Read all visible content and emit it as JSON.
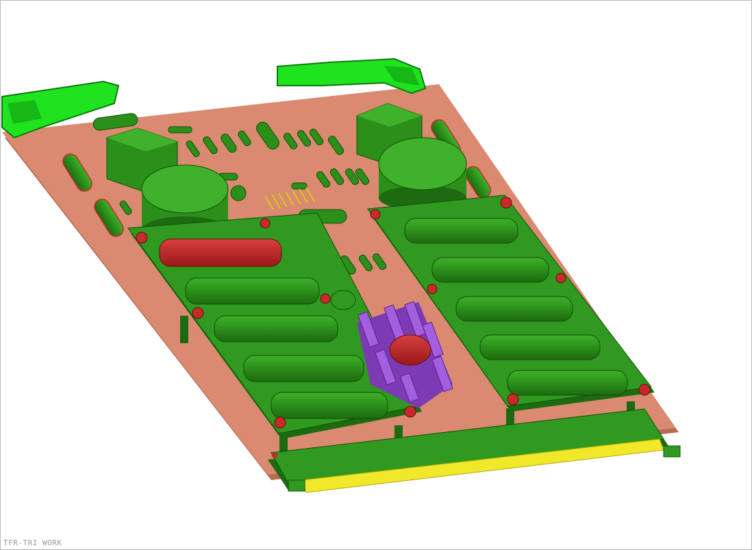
{
  "viewport": {
    "status_label": "TFR-TRI WORK"
  },
  "model": {
    "colors": {
      "board": "#d98a70",
      "board_edge": "#b86a52",
      "component_green": "#2f9a1f",
      "component_dark": "#1e6e12",
      "clip_green": "#1ee31e",
      "capacitor_red": "#c62a2a",
      "heatsink_purple": "#9a4dd6",
      "pins_yellow": "#f1e82a",
      "background": "#ffffff"
    },
    "icon": "pcb-assembly-3d-icon"
  }
}
